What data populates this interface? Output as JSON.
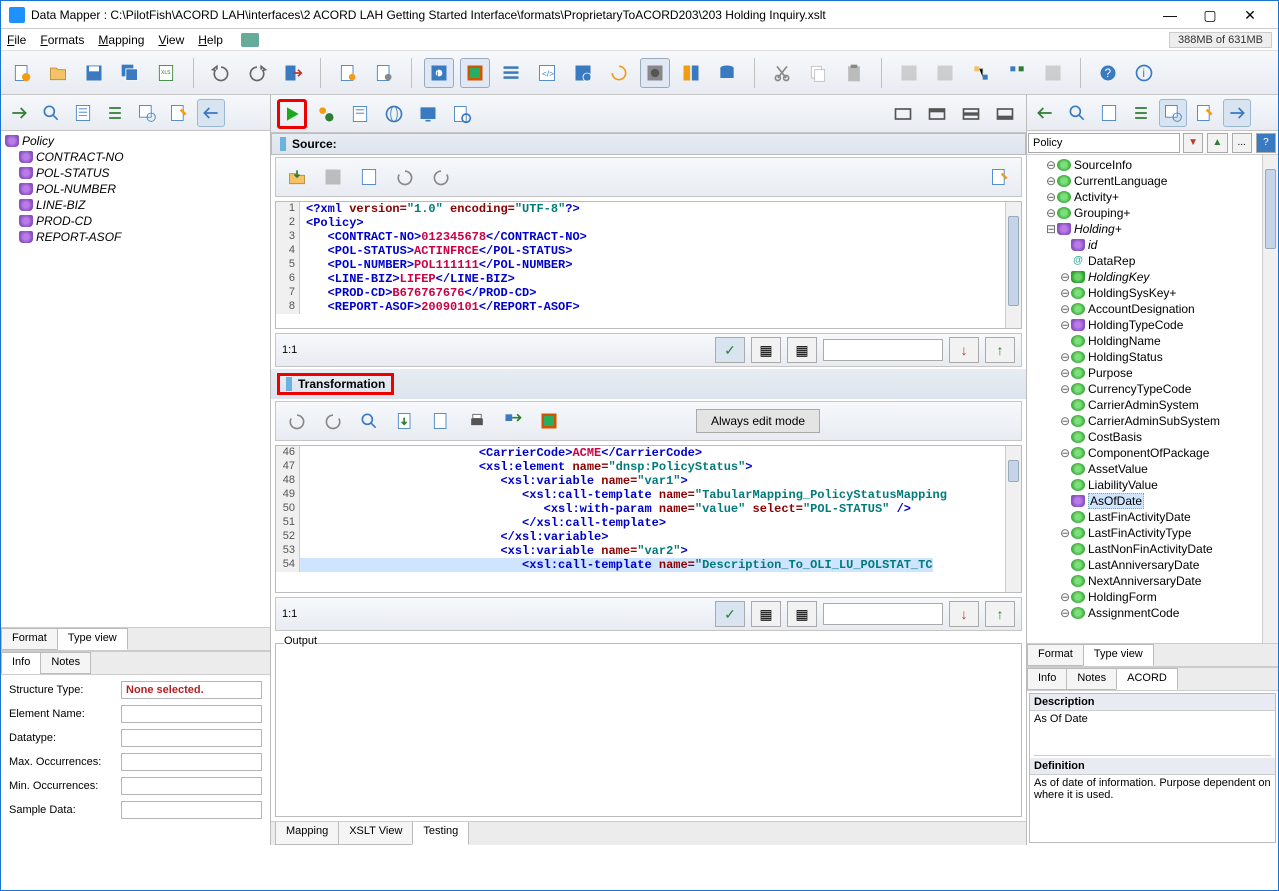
{
  "titlebar": {
    "title": "Data Mapper : C:\\PilotFish\\ACORD LAH\\interfaces\\2 ACORD LAH Getting Started Interface\\formats\\ProprietaryToACORD203\\203 Holding Inquiry.xslt"
  },
  "menu": {
    "file": "File",
    "formats": "Formats",
    "mapping": "Mapping",
    "view": "View",
    "help": "Help"
  },
  "memory": "388MB of 631MB",
  "left_tree": {
    "root": "Policy",
    "items": [
      "CONTRACT-NO",
      "POL-STATUS",
      "POL-NUMBER",
      "LINE-BIZ",
      "PROD-CD",
      "REPORT-ASOF"
    ]
  },
  "left_tabs": {
    "format": "Format",
    "typeview": "Type view",
    "info": "Info",
    "notes": "Notes"
  },
  "info": {
    "structure_type_label": "Structure Type:",
    "structure_type_value": "None selected.",
    "element_name_label": "Element Name:",
    "element_name_value": "",
    "datatype_label": "Datatype:",
    "datatype_value": "",
    "max_occ_label": "Max. Occurrences:",
    "max_occ_value": "",
    "min_occ_label": "Min. Occurrences:",
    "min_occ_value": "",
    "sample_data_label": "Sample Data:",
    "sample_data_value": ""
  },
  "center": {
    "source_label": "Source:",
    "transformation_label": "Transformation",
    "output_label": "Output",
    "edit_mode": "Always edit mode",
    "ratio": "1:1",
    "bottom_tabs": {
      "mapping": "Mapping",
      "xslt": "XSLT View",
      "testing": "Testing"
    }
  },
  "right_filter": "Policy",
  "right_filter_btn": "...",
  "right_tree": [
    {
      "lvl": 1,
      "icon": "green",
      "label": "SourceInfo",
      "toggle": "⊖"
    },
    {
      "lvl": 1,
      "icon": "green",
      "label": "CurrentLanguage",
      "toggle": "⊖"
    },
    {
      "lvl": 1,
      "icon": "green",
      "label": "Activity+",
      "toggle": "⊖"
    },
    {
      "lvl": 1,
      "icon": "green",
      "label": "Grouping+",
      "toggle": "⊖"
    },
    {
      "lvl": 1,
      "icon": "shield",
      "label": "Holding+",
      "toggle": "⊟",
      "italic": true
    },
    {
      "lvl": 2,
      "icon": "shield",
      "label": "id",
      "italic": true
    },
    {
      "lvl": 2,
      "icon": "at",
      "label": "DataRep"
    },
    {
      "lvl": 2,
      "icon": "gshield",
      "label": "HoldingKey",
      "toggle": "⊖",
      "italic": true
    },
    {
      "lvl": 2,
      "icon": "green",
      "label": "HoldingSysKey+",
      "toggle": "⊖"
    },
    {
      "lvl": 2,
      "icon": "green",
      "label": "AccountDesignation",
      "toggle": "⊖"
    },
    {
      "lvl": 2,
      "icon": "shield",
      "label": "HoldingTypeCode",
      "toggle": "⊖"
    },
    {
      "lvl": 2,
      "icon": "green",
      "label": "HoldingName"
    },
    {
      "lvl": 2,
      "icon": "green",
      "label": "HoldingStatus",
      "toggle": "⊖"
    },
    {
      "lvl": 2,
      "icon": "green",
      "label": "Purpose",
      "toggle": "⊖"
    },
    {
      "lvl": 2,
      "icon": "green",
      "label": "CurrencyTypeCode",
      "toggle": "⊖"
    },
    {
      "lvl": 2,
      "icon": "green",
      "label": "CarrierAdminSystem"
    },
    {
      "lvl": 2,
      "icon": "green",
      "label": "CarrierAdminSubSystem",
      "toggle": "⊖"
    },
    {
      "lvl": 2,
      "icon": "green",
      "label": "CostBasis"
    },
    {
      "lvl": 2,
      "icon": "green",
      "label": "ComponentOfPackage",
      "toggle": "⊖"
    },
    {
      "lvl": 2,
      "icon": "green",
      "label": "AssetValue"
    },
    {
      "lvl": 2,
      "icon": "green",
      "label": "LiabilityValue"
    },
    {
      "lvl": 2,
      "icon": "shield",
      "label": "AsOfDate",
      "selected": true
    },
    {
      "lvl": 2,
      "icon": "green",
      "label": "LastFinActivityDate"
    },
    {
      "lvl": 2,
      "icon": "green",
      "label": "LastFinActivityType",
      "toggle": "⊖"
    },
    {
      "lvl": 2,
      "icon": "green",
      "label": "LastNonFinActivityDate"
    },
    {
      "lvl": 2,
      "icon": "green",
      "label": "LastAnniversaryDate"
    },
    {
      "lvl": 2,
      "icon": "green",
      "label": "NextAnniversaryDate"
    },
    {
      "lvl": 2,
      "icon": "green",
      "label": "HoldingForm",
      "toggle": "⊖"
    },
    {
      "lvl": 2,
      "icon": "green",
      "label": "AssignmentCode",
      "toggle": "⊖"
    }
  ],
  "right_tabs": {
    "format": "Format",
    "typeview": "Type view",
    "info": "Info",
    "notes": "Notes",
    "acord": "ACORD"
  },
  "right_desc": {
    "desc_label": "Description",
    "desc_text": "As Of Date",
    "def_label": "Definition",
    "def_text": "As of date of information. Purpose dependent on where it is used."
  }
}
